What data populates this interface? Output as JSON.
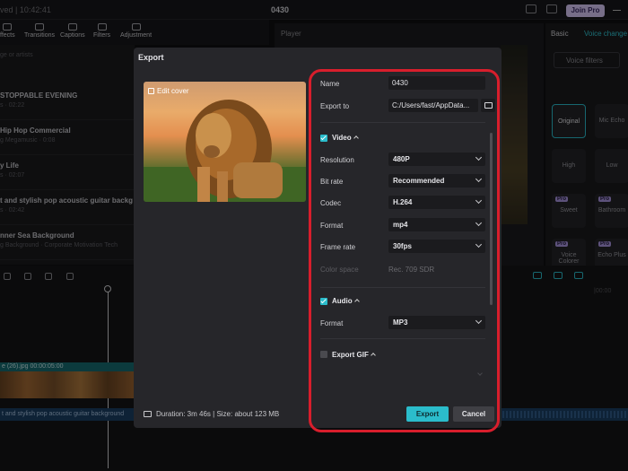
{
  "app": {
    "saved_text": "ved | 10:42:41",
    "project_title": "0430",
    "join_pro_label": "Join Pro"
  },
  "toolbar": {
    "tools": [
      "ffects",
      "Transitions",
      "Captions",
      "Filters",
      "Adjustment"
    ]
  },
  "media": {
    "search_placeholder": "ge or artists",
    "tracks": [
      {
        "title": "STOPPABLE EVENING",
        "meta": "s · 02:22"
      },
      {
        "title": "Hip Hop Commercial",
        "meta": "g Megamusic · 0:08"
      },
      {
        "title": "y Life",
        "meta": "s · 02:07"
      },
      {
        "title": "t and stylish pop acoustic guitar backg",
        "meta": "s · 02:42"
      },
      {
        "title": "nner Sea Background",
        "meta": "g Background · Corporate Motivation Tech"
      }
    ]
  },
  "player": {
    "label": "Player"
  },
  "right_panel": {
    "tab_basic": "Basic",
    "tab_voice": "Voice change",
    "voice_filters_label": "Voice filters",
    "options": [
      {
        "label": "Original",
        "pro": false,
        "selected": true
      },
      {
        "label": "Mic Echo",
        "pro": false,
        "selected": false
      },
      {
        "label": "High",
        "pro": false,
        "selected": false
      },
      {
        "label": "Low",
        "pro": false,
        "selected": false
      },
      {
        "label": "Sweet",
        "pro": true,
        "selected": false
      },
      {
        "label": "Bathroom",
        "pro": true,
        "selected": false
      },
      {
        "label": "Voice Colorer",
        "pro": true,
        "selected": false
      },
      {
        "label": "Echo Plus",
        "pro": true,
        "selected": false
      }
    ],
    "pro_badge": "Pro"
  },
  "timeline": {
    "clip_label": "e (26).jpg  00:00:05:00",
    "audio_label": "t and stylish pop acoustic guitar background",
    "time_readout": "|00:00"
  },
  "export_dialog": {
    "title": "Export",
    "edit_cover_label": "Edit cover",
    "name_label": "Name",
    "name_value": "0430",
    "export_to_label": "Export to",
    "export_to_value": "C:/Users/fast/AppData...",
    "video_section": "Video",
    "video_enabled": true,
    "resolution_label": "Resolution",
    "resolution_value": "480P",
    "bitrate_label": "Bit rate",
    "bitrate_value": "Recommended",
    "codec_label": "Codec",
    "codec_value": "H.264",
    "format_label": "Format",
    "format_value": "mp4",
    "framerate_label": "Frame rate",
    "framerate_value": "30fps",
    "colorspace_label": "Color space",
    "colorspace_value": "Rec. 709 SDR",
    "audio_section": "Audio",
    "audio_enabled": true,
    "audio_format_label": "Format",
    "audio_format_value": "MP3",
    "gif_section": "Export GIF",
    "gif_enabled": false,
    "summary": "Duration: 3m 46s | Size: about 123 MB",
    "export_button": "Export",
    "cancel_button": "Cancel"
  },
  "colors": {
    "accent": "#2bbccb",
    "highlight_outline": "#d81e2c",
    "dialog_bg": "#26262a",
    "join_pro_bg": "#d9c8f7"
  }
}
